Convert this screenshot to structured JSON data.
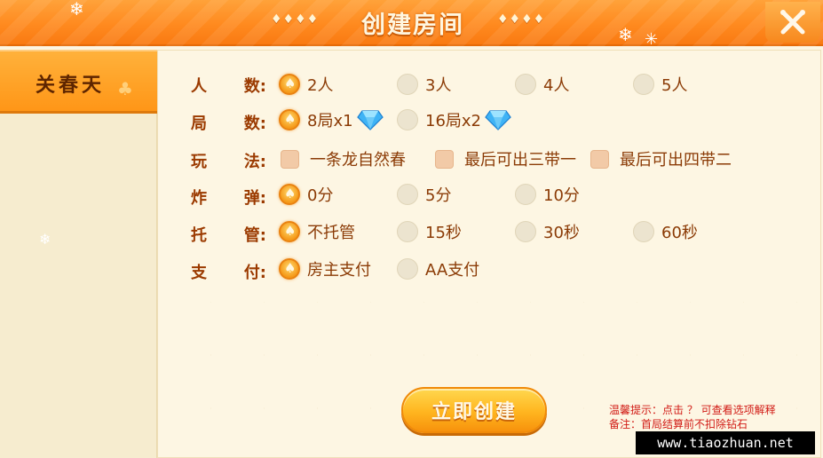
{
  "header": {
    "title": "创建房间",
    "deco_left": "♦♦♦♦",
    "deco_right": "♦♦♦♦",
    "close_icon": "crossed-close-icon",
    "colors": {
      "bar": "#ff8a1f",
      "title_text": "#fff6df"
    }
  },
  "sidebar": {
    "tabs": [
      {
        "label": "关春天",
        "selected": true
      }
    ]
  },
  "rows": [
    {
      "label_left": "人",
      "label_right": "数:",
      "type": "radio",
      "options": [
        {
          "label": "2人",
          "selected": true
        },
        {
          "label": "3人",
          "selected": false
        },
        {
          "label": "4人",
          "selected": false
        },
        {
          "label": "5人",
          "selected": false
        }
      ]
    },
    {
      "label_left": "局",
      "label_right": "数:",
      "type": "radio",
      "options": [
        {
          "label": "8局x1",
          "selected": true,
          "icon": "diamond-gem-icon"
        },
        {
          "label": "16局x2",
          "selected": false,
          "icon": "diamond-gem-icon"
        }
      ]
    },
    {
      "label_left": "玩",
      "label_right": "法:",
      "type": "checkbox",
      "options": [
        {
          "label": "一条龙自然春",
          "checked": false
        },
        {
          "label": "最后可出三带一",
          "checked": false
        },
        {
          "label": "最后可出四带二",
          "checked": false
        }
      ]
    },
    {
      "label_left": "炸",
      "label_right": "弹:",
      "type": "radio",
      "options": [
        {
          "label": "0分",
          "selected": true
        },
        {
          "label": "5分",
          "selected": false
        },
        {
          "label": "10分",
          "selected": false
        }
      ]
    },
    {
      "label_left": "托",
      "label_right": "管:",
      "type": "radio",
      "options": [
        {
          "label": "不托管",
          "selected": true
        },
        {
          "label": "15秒",
          "selected": false
        },
        {
          "label": "30秒",
          "selected": false
        },
        {
          "label": "60秒",
          "selected": false
        }
      ]
    },
    {
      "label_left": "支",
      "label_right": "付:",
      "type": "radio",
      "options": [
        {
          "label": "房主支付",
          "selected": true
        },
        {
          "label": "AA支付",
          "selected": false
        }
      ]
    }
  ],
  "create_button": {
    "label": "立即创建"
  },
  "hints": {
    "line1": "温馨提示：点击 ？ 可查看选项解释",
    "line2": "备注：首局结算前不扣除钻石"
  },
  "watermark": "www.tiaozhuan.net"
}
